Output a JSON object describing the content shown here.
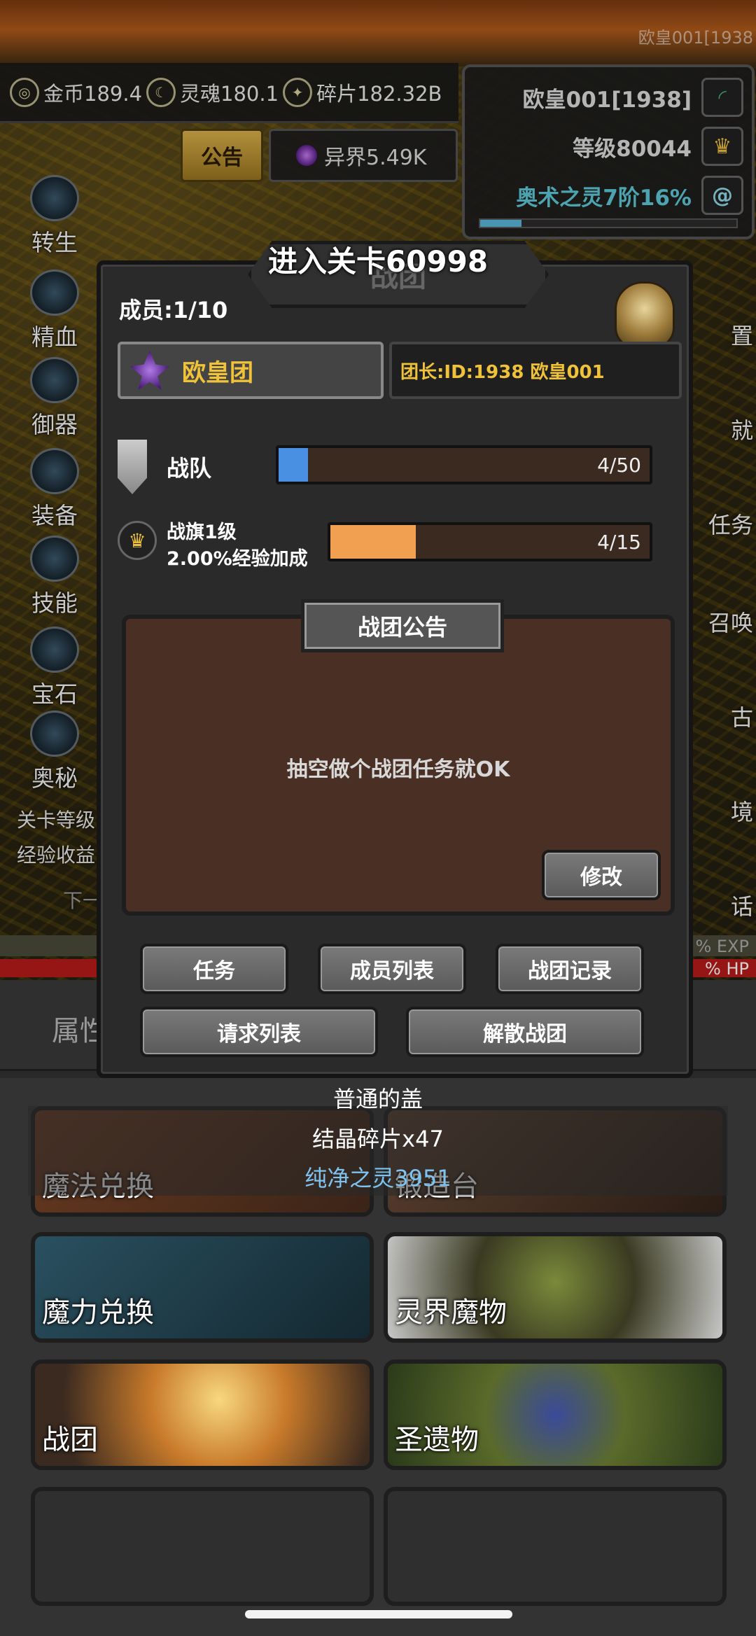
{
  "watermark": "欧皇001[1938",
  "currencies": {
    "gold": "金币189.4",
    "soul": "灵魂180.1",
    "shard": "碎片182.32B"
  },
  "notice_tab": "公告",
  "realm": "异界5.49K",
  "player": {
    "name": "欧皇001[1938]",
    "level": "等级80044",
    "arcane": "奥术之灵7阶16%",
    "xp_fraction": 0.16
  },
  "side_menu": [
    "转生",
    "精血",
    "御器",
    "装备",
    "技能",
    "宝石",
    "奥秘"
  ],
  "side_labels": [
    "关卡等级",
    "经验收益",
    "下一"
  ],
  "right_menu": [
    "置",
    "就",
    "任务",
    "召唤",
    "古",
    "境",
    "话"
  ],
  "bars_text": {
    "exp": "% EXP",
    "hp": "% HP"
  },
  "dialog": {
    "title_faint": "战团",
    "level_banner": "进入关卡60998",
    "members": "成员:1/10",
    "guild_name": "欧皇团",
    "leader": "团长:ID:1938 欧皇001",
    "team": {
      "label": "战队",
      "value": "4/50",
      "fraction": 0.08,
      "color": "#4a90e2"
    },
    "flag": {
      "label_line1": "战旗1级",
      "label_line2": "2.00%经验加成",
      "value": "4/15",
      "fraction": 0.267,
      "color": "#f0a050"
    },
    "notice_title": "战团公告",
    "notice_text": "抽空做个战团任务就OK",
    "edit": "修改",
    "buttons_row1": [
      "任务",
      "成员列表",
      "战团记录"
    ],
    "buttons_row2": [
      "请求列表",
      "解散战团"
    ]
  },
  "bottom_tab": "属性",
  "rewards": {
    "line1": "普通的盖",
    "line2": "结晶碎片x47",
    "line3": "纯净之灵3951",
    "line3_color": "#7ec3f0"
  },
  "cards": [
    "魔法兑换",
    "锻造台",
    "魔力兑换",
    "灵界魔物",
    "战团",
    "圣遗物"
  ]
}
